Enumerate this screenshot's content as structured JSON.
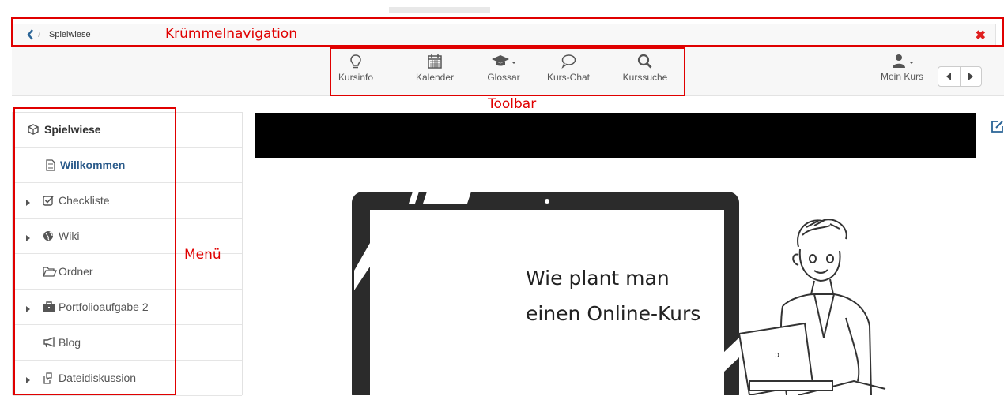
{
  "breadcrumb": {
    "separator": "/",
    "item": "Spielwiese",
    "close_glyph": "✖"
  },
  "toolbar": {
    "tools": [
      {
        "label": "Kursinfo",
        "icon": "lightbulb-icon"
      },
      {
        "label": "Kalender",
        "icon": "calendar-icon"
      },
      {
        "label": "Glossar",
        "icon": "graduation-cap-icon"
      },
      {
        "label": "Kurs-Chat",
        "icon": "chat-bubble-icon"
      },
      {
        "label": "Kurssuche",
        "icon": "search-icon"
      }
    ],
    "my_course": "Mein Kurs"
  },
  "annotations": {
    "breadcrumb": "Krümmelnavigation",
    "toolbar": "Toolbar",
    "menu": "Menü"
  },
  "menu": {
    "items": [
      {
        "label": "Spielwiese",
        "icon": "cube-icon",
        "expandable": false
      },
      {
        "label": "Willkommen",
        "icon": "document-icon",
        "expandable": false
      },
      {
        "label": "Checkliste",
        "icon": "checkbox-icon",
        "expandable": true
      },
      {
        "label": "Wiki",
        "icon": "globe-icon",
        "expandable": true
      },
      {
        "label": "Ordner",
        "icon": "folder-open-icon",
        "expandable": false
      },
      {
        "label": "Portfolioaufgabe 2",
        "icon": "briefcase-icon",
        "expandable": true
      },
      {
        "label": "Blog",
        "icon": "megaphone-icon",
        "expandable": false
      },
      {
        "label": "Dateidiskussion",
        "icon": "discussion-files-icon",
        "expandable": true
      }
    ]
  },
  "content": {
    "slide_text_line1": "Wie plant man",
    "slide_text_line2": "einen Online-Kurs",
    "laptop_sticker": "ᴐ"
  },
  "colors": {
    "annotation": "#e00000",
    "link": "#2a6496",
    "banner": "#000000"
  }
}
